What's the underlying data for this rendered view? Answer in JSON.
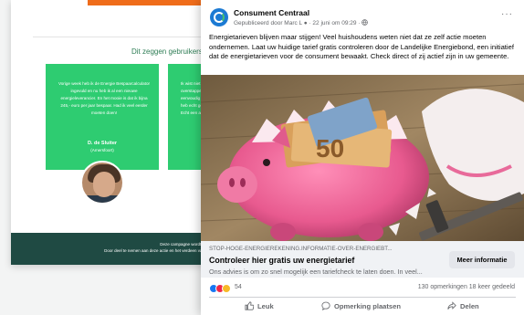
{
  "site": {
    "heading": "Dit zeggen gebruikers",
    "testimonial_left": {
      "quote": "Vorige week heb ik de Energie Bespaarcalculator ingevuld en nu heb ik al een nieuwe energieleverancier. En het mooie is dat ik bijna 245,- euro per jaar bespaar. Had ik veel eerder moeten doen!",
      "name": "D. de Sluiter",
      "city": "(Amersfoort)"
    },
    "testimonial_right": {
      "quote": "Ik wist niet dat overstappen zo eenvoudig was. Ik heb echt geregeld. Echt een aanrader!"
    },
    "footer": {
      "line1": "Deze campagne wordt u",
      "line2": "Door deel te nemen aan deze actie en het verdeen van"
    },
    "colors": {
      "green": "#2ecc71",
      "dark_green": "#1f4a43",
      "orange": "#ef6c1a"
    }
  },
  "post": {
    "page_name": "Consument Centraal",
    "meta": "Gepubliceerd door Marc L ● · 22 juni om 09:29 ·",
    "more": "···",
    "text": "Energietarieven blijven maar stijgen! Veel huishoudens weten niet dat ze zelf actie moeten ondernemen. Laat uw huidige tarief gratis controleren door de Landelijke Energiebond, een initiatief dat de energietarieven voor de consument bewaakt. Check direct of zij actief zijn in uw gemeente.",
    "image_label": "50",
    "link": {
      "domain": "STOP-HOGE-ENERGIEREKENING.INFORMATIE-OVER-ENERGIEBT...",
      "title": "Controleer hier gratis uw energietarief",
      "description": "Ons advies is om zo snel mogelijk een tariefcheck te laten doen. In veel...",
      "button": "Meer informatie"
    },
    "reactions_count": "54",
    "stats": "130 opmerkingen  18 keer gedeeld",
    "actions": {
      "like": "Leuk",
      "comment": "Opmerking plaatsen",
      "share": "Delen"
    },
    "colors": {
      "facebook_blue": "#1877f2",
      "pig_pink": "#f0679a"
    }
  }
}
